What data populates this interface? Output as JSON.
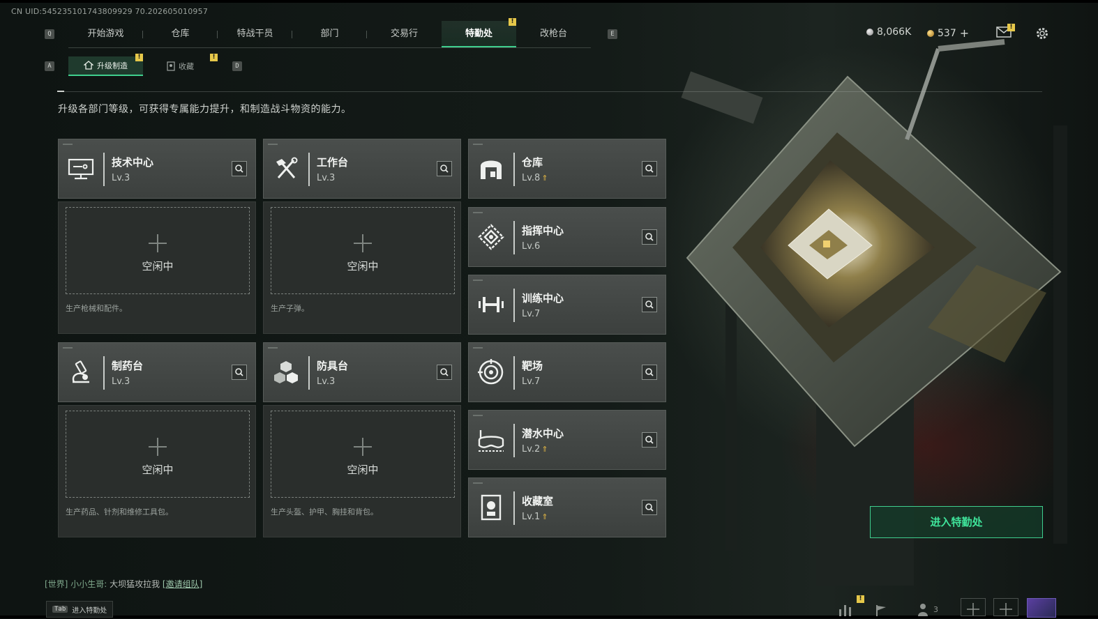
{
  "uid": "CN UID:545235101743809929 70.202605010957",
  "nav": {
    "key_left": "Q",
    "key_right": "E",
    "tabs": [
      {
        "label": "开始游戏"
      },
      {
        "label": "仓库"
      },
      {
        "label": "特战干员"
      },
      {
        "label": "部门"
      },
      {
        "label": "交易行"
      },
      {
        "label": "特勤处",
        "active": true,
        "badge": "!"
      },
      {
        "label": "改枪台"
      }
    ]
  },
  "subnav": {
    "key_left": "A",
    "key_right": "D",
    "tabs": [
      {
        "label": "升级制造",
        "active": true,
        "badge": "!"
      },
      {
        "label": "收藏",
        "badge": "!"
      }
    ]
  },
  "currency": {
    "silver": "8,066K",
    "gold": "537",
    "plus": "+"
  },
  "mail_badge": "!",
  "description": "升级各部门等级，可获得专属能力提升，和制造战斗物资的能力。",
  "production": [
    {
      "name": "技术中心",
      "level": "Lv.3",
      "icon": "computer-icon",
      "idle": "空闲中",
      "desc": "生产枪械和配件。"
    },
    {
      "name": "工作台",
      "level": "Lv.3",
      "icon": "tools-icon",
      "idle": "空闲中",
      "desc": "生产子弹。"
    },
    {
      "name": "制药台",
      "level": "Lv.3",
      "icon": "microscope-icon",
      "idle": "空闲中",
      "desc": "生产药品、针剂和维修工具包。"
    },
    {
      "name": "防具台",
      "level": "Lv.3",
      "icon": "armor-blocks-icon",
      "idle": "空闲中",
      "desc": "生产头盔、护甲、胸挂和背包。"
    }
  ],
  "facilities": [
    {
      "name": "仓库",
      "level": "Lv.8",
      "upgradable": true,
      "icon": "warehouse-icon"
    },
    {
      "name": "指挥中心",
      "level": "Lv.6",
      "upgradable": false,
      "icon": "command-icon"
    },
    {
      "name": "训练中心",
      "level": "Lv.7",
      "upgradable": false,
      "icon": "dumbbell-icon"
    },
    {
      "name": "靶场",
      "level": "Lv.7",
      "upgradable": false,
      "icon": "target-icon"
    },
    {
      "name": "潜水中心",
      "level": "Lv.2",
      "upgradable": true,
      "icon": "diving-mask-icon"
    },
    {
      "name": "收藏室",
      "level": "Lv.1",
      "upgradable": true,
      "icon": "collection-icon"
    }
  ],
  "enter_button": "进入特勤处",
  "chat": {
    "channel": "[世界]",
    "sender": "小小生哥:",
    "message": "大坝猛攻拉我",
    "link": "[邀请组队]"
  },
  "tab_hint": {
    "key": "Tab",
    "label": "进入特勤处"
  },
  "bottom": {
    "badge": "!",
    "friends_count": "3"
  },
  "colors": {
    "accent": "#3fcf8e",
    "badge": "#e6c84a",
    "upgrade_arrow": "#e0b544"
  }
}
